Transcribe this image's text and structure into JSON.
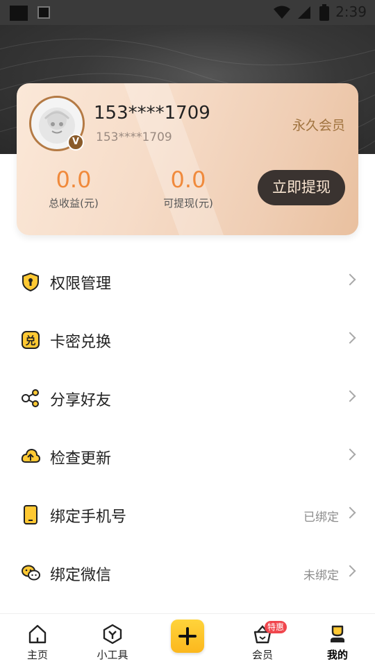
{
  "status_bar": {
    "time": "2:39"
  },
  "profile": {
    "phone_masked": "153****1709",
    "phone_masked_sub": "153****1709",
    "member_type": "永久会员",
    "badge_letter": "V"
  },
  "stats": [
    {
      "value": "0.0",
      "label": "总收益(元)"
    },
    {
      "value": "0.0",
      "label": "可提现(元)"
    }
  ],
  "withdraw_label": "立即提现",
  "menu": [
    {
      "label": "权限管理",
      "icon": "shield-lock-icon",
      "value": ""
    },
    {
      "label": "卡密兑换",
      "icon": "redeem-icon",
      "value": ""
    },
    {
      "label": "分享好友",
      "icon": "share-icon",
      "value": ""
    },
    {
      "label": "检查更新",
      "icon": "cloud-upload-icon",
      "value": ""
    },
    {
      "label": "绑定手机号",
      "icon": "phone-icon",
      "value": "已绑定"
    },
    {
      "label": "绑定微信",
      "icon": "wechat-icon",
      "value": "未绑定"
    }
  ],
  "redeem_glyph": "兑",
  "bottom_nav": {
    "items": [
      {
        "label": "主页",
        "icon": "home-icon"
      },
      {
        "label": "小工具",
        "icon": "tools-icon"
      },
      {
        "label": "",
        "icon": "plus-icon"
      },
      {
        "label": "会员",
        "icon": "vip-basket-icon",
        "badge": "特惠"
      },
      {
        "label": "我的",
        "icon": "profile-icon",
        "active": true
      }
    ]
  },
  "colors": {
    "accent": "#FBB71D",
    "stat_number": "#F08A3C",
    "withdraw_button": "#3A3330",
    "member_text": "#A0733F",
    "badge_red": "#F0464D"
  }
}
